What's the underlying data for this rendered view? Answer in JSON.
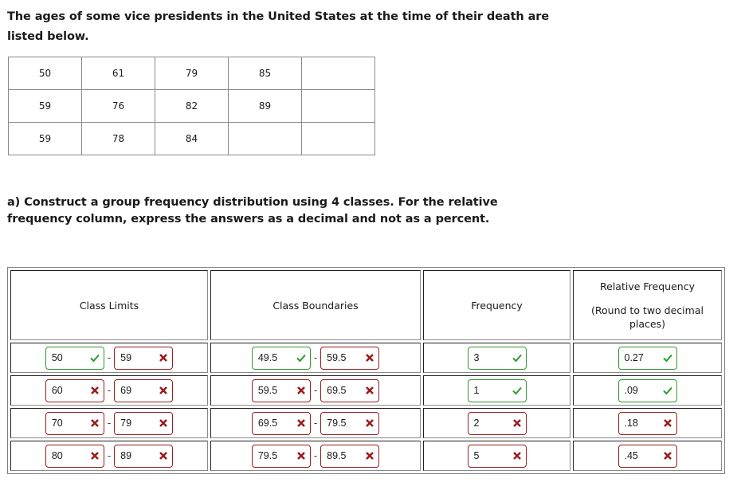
{
  "intro": "The ages of some vice presidents in the United States at the time of their death are listed below.",
  "ages_table": [
    [
      "50",
      "61",
      "79",
      "85",
      ""
    ],
    [
      "59",
      "76",
      "82",
      "89",
      ""
    ],
    [
      "59",
      "78",
      "84",
      "",
      ""
    ]
  ],
  "question": "a) Construct a group frequency distribution using 4 classes. For the relative frequency column, express the answers as a decimal and not as a percent.",
  "headers": {
    "class_limits": "Class Limits",
    "class_boundaries": "Class Boundaries",
    "frequency": "Frequency",
    "relative_frequency": "Relative Frequency",
    "relative_frequency_note": "(Round to two decimal places)"
  },
  "separator": "-",
  "colors": {
    "correct": "#2e9a2e",
    "incorrect": "#9b1c1c"
  },
  "rows": [
    {
      "lower_limit": {
        "value": "50",
        "status": "correct"
      },
      "upper_limit": {
        "value": "59",
        "status": "incorrect"
      },
      "lower_boundary": {
        "value": "49.5",
        "status": "correct"
      },
      "upper_boundary": {
        "value": "59.5",
        "status": "incorrect"
      },
      "frequency": {
        "value": "3",
        "status": "correct"
      },
      "relative_frequency": {
        "value": "0.27",
        "status": "correct"
      }
    },
    {
      "lower_limit": {
        "value": "60",
        "status": "incorrect"
      },
      "upper_limit": {
        "value": "69",
        "status": "incorrect"
      },
      "lower_boundary": {
        "value": "59.5",
        "status": "incorrect"
      },
      "upper_boundary": {
        "value": "69.5",
        "status": "incorrect"
      },
      "frequency": {
        "value": "1",
        "status": "correct"
      },
      "relative_frequency": {
        "value": ".09",
        "status": "correct"
      }
    },
    {
      "lower_limit": {
        "value": "70",
        "status": "incorrect"
      },
      "upper_limit": {
        "value": "79",
        "status": "incorrect"
      },
      "lower_boundary": {
        "value": "69.5",
        "status": "incorrect"
      },
      "upper_boundary": {
        "value": "79.5",
        "status": "incorrect"
      },
      "frequency": {
        "value": "2",
        "status": "incorrect"
      },
      "relative_frequency": {
        "value": ".18",
        "status": "incorrect"
      }
    },
    {
      "lower_limit": {
        "value": "80",
        "status": "incorrect"
      },
      "upper_limit": {
        "value": "89",
        "status": "incorrect"
      },
      "lower_boundary": {
        "value": "79.5",
        "status": "incorrect"
      },
      "upper_boundary": {
        "value": "89.5",
        "status": "incorrect"
      },
      "frequency": {
        "value": "5",
        "status": "incorrect"
      },
      "relative_frequency": {
        "value": ".45",
        "status": "incorrect"
      }
    }
  ]
}
